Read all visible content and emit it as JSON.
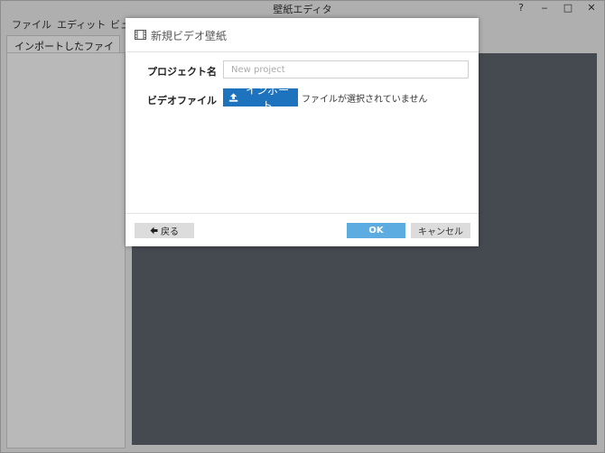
{
  "window": {
    "title": "壁紙エディタ",
    "controls": {
      "help": "?",
      "minimize": "‒",
      "maximize": "□",
      "close": "✕"
    }
  },
  "menubar": {
    "items": [
      "ファイル",
      "エディット",
      "ビュ"
    ]
  },
  "left_tab": {
    "label": "インポートしたファイル"
  },
  "dialog": {
    "title": "新規ビデオ壁紙",
    "project_name_label": "プロジェクト名",
    "project_name_placeholder": "New project",
    "project_name_value": "",
    "video_file_label": "ビデオファイル",
    "import_button_label": "インポート",
    "no_file_text": "ファイルが選択されていません",
    "back_button_label": "戻る",
    "ok_button_label": "OK",
    "cancel_button_label": "キャンセル"
  },
  "colors": {
    "accent_blue": "#1e73be",
    "ok_blue": "#5dace1",
    "canvas_gray": "#5b616a"
  },
  "icons": {
    "dialog": "film-icon",
    "import": "upload-icon",
    "back": "arrow-left-icon"
  }
}
